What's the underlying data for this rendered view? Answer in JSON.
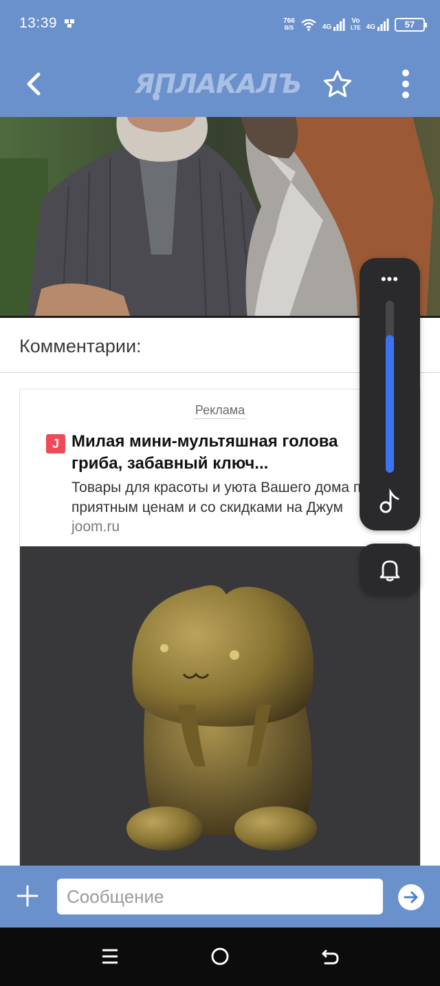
{
  "status_bar": {
    "time": "13:39",
    "net_speed_value": "766",
    "net_speed_unit": "B/S",
    "signal_1_label": "4G",
    "volte_label": "Vo",
    "volte_sub": "LTE",
    "signal_2_label": "4G",
    "battery": "57"
  },
  "header": {
    "logo_text": "ЯПЛАКАЛЪ"
  },
  "comments": {
    "title": "Комментарии:"
  },
  "ad": {
    "label": "Реклама",
    "logo_letter": "J",
    "title_line1": "Милая мини-мультяшная голова",
    "title_line2": "гриба, забавный ключ...",
    "desc_line1": "Товары для красоты и уюта Вашего дома по",
    "desc_line2": "приятным ценам и со скидками на Джум",
    "domain": "joom.ru"
  },
  "volume_panel": {
    "menu_label": "•••",
    "level": 0.8
  },
  "composer": {
    "placeholder": "Сообщение",
    "value": ""
  },
  "colors": {
    "brand_blue": "#6a91cc",
    "panel_dark": "#2a2a2c",
    "volume_fill": "#3b74f0",
    "ad_logo": "#ee4a57"
  }
}
